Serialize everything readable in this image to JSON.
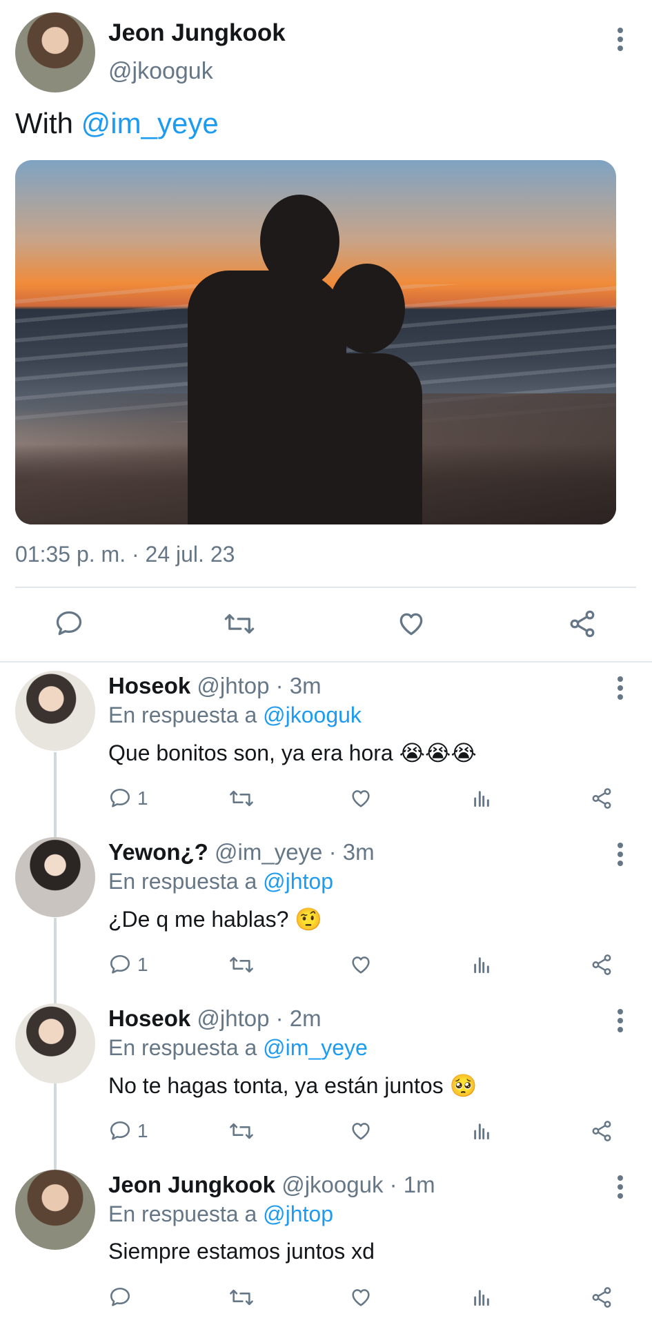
{
  "main_tweet": {
    "author_name": "Jeon Jungkook",
    "author_handle": "@jkooguk",
    "text_prefix": "With ",
    "mention": "@im_yeye",
    "timestamp": "01:35 p. m. · 24 jul. 23"
  },
  "replies": [
    {
      "name": "Hoseok",
      "handle": "@jhtop · 3m",
      "reply_prefix": "En respuesta a ",
      "reply_to": "@jkooguk",
      "text": "Que bonitos son, ya era hora 😭😭😭",
      "reply_count": "1"
    },
    {
      "name": "Yewon¿?",
      "handle": "@im_yeye · 3m",
      "reply_prefix": "En respuesta a ",
      "reply_to": "@jhtop",
      "text": "¿De q me hablas? 🤨",
      "reply_count": "1"
    },
    {
      "name": "Hoseok",
      "handle": "@jhtop · 2m",
      "reply_prefix": "En respuesta a ",
      "reply_to": "@im_yeye",
      "text": "No te hagas tonta, ya están juntos 🥺",
      "reply_count": "1"
    },
    {
      "name": "Jeon Jungkook",
      "handle": "@jkooguk · 1m",
      "reply_prefix": "En respuesta a ",
      "reply_to": "@jhtop",
      "text": "Siempre estamos juntos xd",
      "reply_count": ""
    }
  ],
  "icons": {
    "reply": "comment-icon",
    "retweet": "retweet-icon",
    "like": "heart-icon",
    "analytics": "analytics-icon",
    "share": "share-icon",
    "more": "more-vertical-icon"
  },
  "colors": {
    "accent": "#1d9bf0",
    "muted": "#657786",
    "text": "#14171a"
  }
}
